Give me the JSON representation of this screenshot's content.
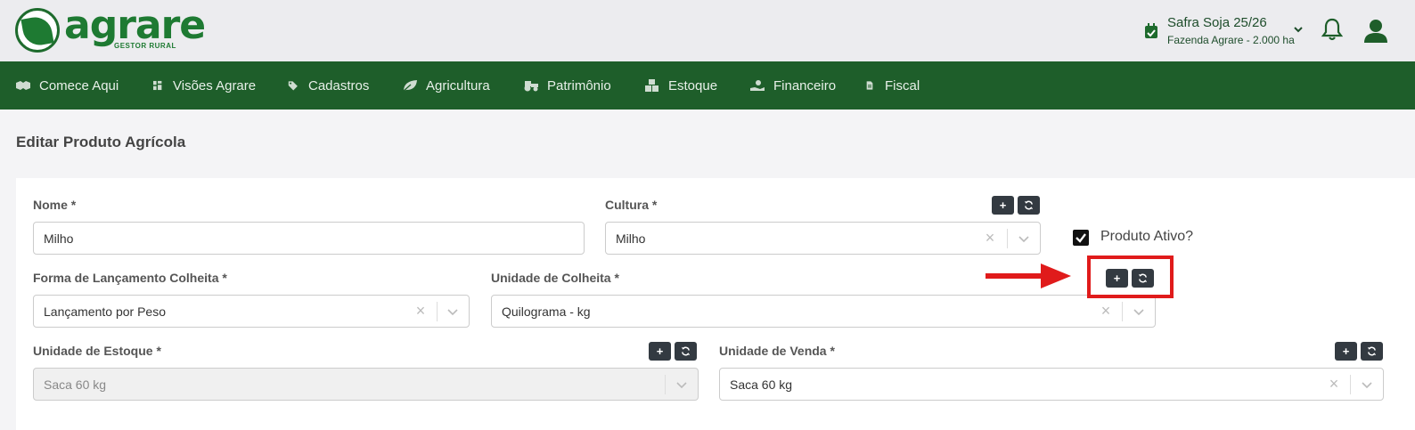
{
  "header": {
    "brand": "agrare",
    "brand_sub": "GESTOR RURAL",
    "season": "Safra Soja 25/26",
    "farm": "Fazenda Agrare - 2.000 ha"
  },
  "nav": {
    "items": [
      {
        "label": "Comece Aqui",
        "icon": "handshake-icon"
      },
      {
        "label": "Visões Agrare",
        "icon": "dashboard-icon"
      },
      {
        "label": "Cadastros",
        "icon": "tags-icon"
      },
      {
        "label": "Agricultura",
        "icon": "leaf-icon"
      },
      {
        "label": "Patrimônio",
        "icon": "tractor-icon"
      },
      {
        "label": "Estoque",
        "icon": "boxes-icon"
      },
      {
        "label": "Financeiro",
        "icon": "hand-coin-icon"
      },
      {
        "label": "Fiscal",
        "icon": "invoice-icon"
      }
    ]
  },
  "page": {
    "title": "Editar Produto Agrícola"
  },
  "form": {
    "nome": {
      "label": "Nome *",
      "value": "Milho"
    },
    "cultura": {
      "label": "Cultura *",
      "value": "Milho"
    },
    "ativo": {
      "label": "Produto Ativo?",
      "checked": true
    },
    "forma": {
      "label": "Forma de Lançamento Colheita *",
      "value": "Lançamento por Peso"
    },
    "unidade_colheita": {
      "label": "Unidade de Colheita *",
      "value": "Quilograma - kg"
    },
    "unidade_estoque": {
      "label": "Unidade de Estoque *",
      "value": "Saca 60 kg"
    },
    "unidade_venda": {
      "label": "Unidade de Venda *",
      "value": "Saca 60 kg"
    },
    "add_symbol": "+",
    "clear_symbol": "×"
  },
  "colors": {
    "nav_bg": "#1e5e2a",
    "brand": "#1e7a32",
    "highlight": "#e01b1b",
    "button": "#333a41"
  }
}
